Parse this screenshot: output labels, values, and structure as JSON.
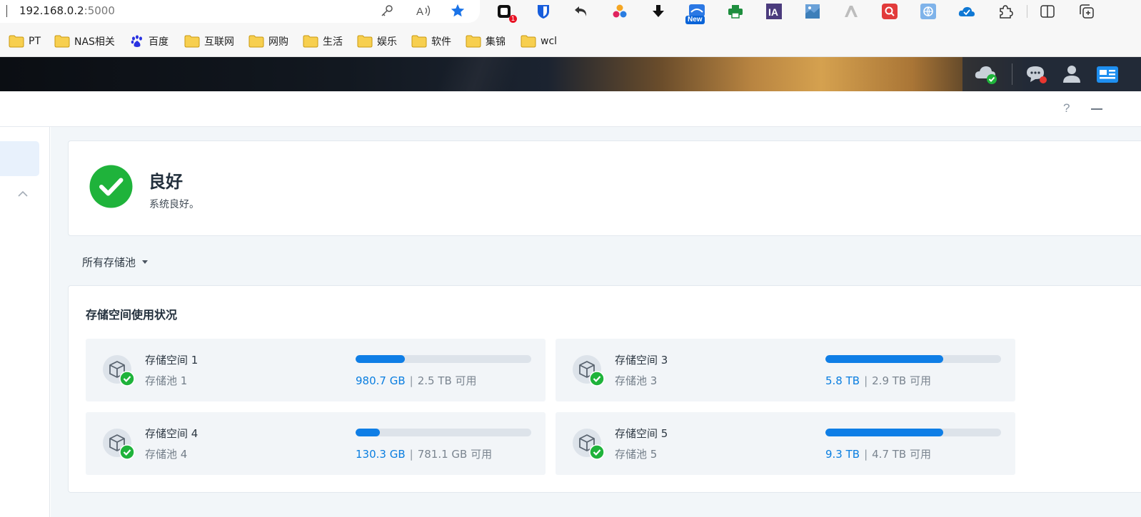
{
  "browser": {
    "address": {
      "host": "192.168.0.2",
      "port": ":5000"
    },
    "extensions": [
      {
        "name": "notion-style-extension-icon",
        "badge": "1"
      },
      {
        "name": "bitwarden-icon"
      },
      {
        "name": "undo-arrow-icon"
      },
      {
        "name": "color-dots-icon"
      },
      {
        "name": "download-arrow-icon"
      },
      {
        "name": "news-extension-icon",
        "badge": "New"
      },
      {
        "name": "printer-icon"
      },
      {
        "name": "ia-icon",
        "label": "IA"
      },
      {
        "name": "map-extension-icon"
      },
      {
        "name": "a-logo-icon"
      },
      {
        "name": "red-search-icon"
      },
      {
        "name": "translate-icon"
      },
      {
        "name": "onedrive-icon"
      },
      {
        "name": "puzzle-extensions-icon"
      },
      {
        "name": "split-screen-icon"
      },
      {
        "name": "collections-icon"
      }
    ],
    "bookmarks": [
      {
        "label": "PT",
        "icon": "folder"
      },
      {
        "label": "NAS相关",
        "icon": "folder"
      },
      {
        "label": "百度",
        "icon": "baidu"
      },
      {
        "label": "互联网",
        "icon": "folder"
      },
      {
        "label": "网购",
        "icon": "folder"
      },
      {
        "label": "生活",
        "icon": "folder"
      },
      {
        "label": "娱乐",
        "icon": "folder"
      },
      {
        "label": "软件",
        "icon": "folder"
      },
      {
        "label": "集锦",
        "icon": "folder"
      },
      {
        "label": "wcl",
        "icon": "folder"
      }
    ]
  },
  "window": {
    "help": "?"
  },
  "status": {
    "title": "良好",
    "subtitle": "系统良好。",
    "color": "#1fb33b"
  },
  "pool_filter": {
    "label": "所有存储池"
  },
  "usage": {
    "title": "存储空间使用状况",
    "volumes": [
      {
        "name": "存储空间 1",
        "pool": "存储池 1",
        "used": "980.7 GB",
        "separator": "|",
        "available": "2.5 TB 可用",
        "fraction": 0.28
      },
      {
        "name": "存储空间 3",
        "pool": "存储池 3",
        "used": "5.8 TB",
        "separator": "|",
        "available": "2.9 TB 可用",
        "fraction": 0.67
      },
      {
        "name": "存储空间 4",
        "pool": "存储池 4",
        "used": "130.3 GB",
        "separator": "|",
        "available": "781.1 GB 可用",
        "fraction": 0.14
      },
      {
        "name": "存储空间 5",
        "pool": "存储池 5",
        "used": "9.3 TB",
        "separator": "|",
        "available": "4.7 TB 可用",
        "fraction": 0.67
      }
    ]
  },
  "colors": {
    "accent": "#0f7ee6",
    "ok": "#1fb33b",
    "track": "#dde3ea"
  }
}
